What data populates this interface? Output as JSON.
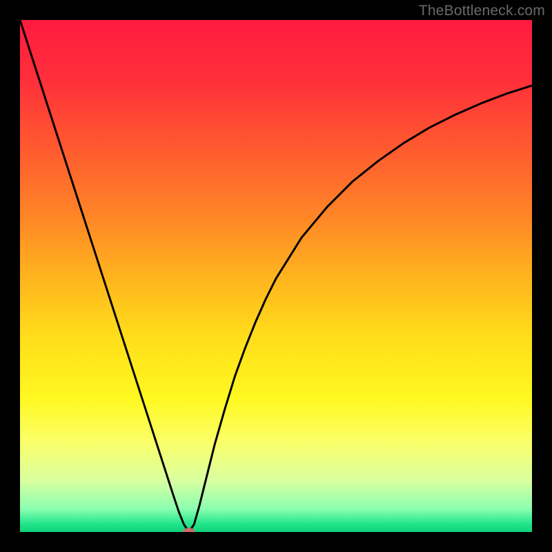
{
  "watermark": "TheBottleneck.com",
  "chart_data": {
    "type": "line",
    "title": "",
    "xlabel": "",
    "ylabel": "",
    "xlim": [
      0,
      100
    ],
    "ylim": [
      0,
      100
    ],
    "background": {
      "type": "vertical-gradient",
      "stops": [
        {
          "pos": 0.0,
          "color": "#ff1a3f"
        },
        {
          "pos": 0.12,
          "color": "#ff303a"
        },
        {
          "pos": 0.25,
          "color": "#ff5a2f"
        },
        {
          "pos": 0.38,
          "color": "#ff8427"
        },
        {
          "pos": 0.5,
          "color": "#ffb31e"
        },
        {
          "pos": 0.62,
          "color": "#ffde1a"
        },
        {
          "pos": 0.74,
          "color": "#fff821"
        },
        {
          "pos": 0.82,
          "color": "#fcff66"
        },
        {
          "pos": 0.9,
          "color": "#d9ffa0"
        },
        {
          "pos": 0.955,
          "color": "#8affb0"
        },
        {
          "pos": 0.985,
          "color": "#20e48a"
        },
        {
          "pos": 1.0,
          "color": "#0fd27a"
        }
      ]
    },
    "series": [
      {
        "name": "bottleneck-curve",
        "color": "#000000",
        "x": [
          0,
          2,
          4,
          6,
          8,
          10,
          12,
          14,
          16,
          18,
          20,
          22,
          24,
          26,
          28,
          30,
          31,
          32,
          33,
          34,
          35,
          36,
          38,
          40,
          42,
          44,
          46,
          48,
          50,
          55,
          60,
          65,
          70,
          75,
          80,
          85,
          90,
          95,
          100
        ],
        "y": [
          100,
          93.8,
          87.6,
          81.4,
          75.2,
          69.0,
          62.8,
          56.6,
          50.4,
          44.2,
          38.0,
          31.8,
          25.6,
          19.4,
          13.2,
          7.0,
          4.0,
          1.5,
          0.0,
          1.5,
          5.0,
          9.0,
          17.0,
          24.0,
          30.5,
          36.0,
          41.0,
          45.5,
          49.5,
          57.5,
          63.5,
          68.5,
          72.5,
          76.0,
          79.0,
          81.5,
          83.7,
          85.6,
          87.2
        ]
      }
    ],
    "marker": {
      "name": "optimal-point",
      "x": 33,
      "y": 0,
      "color": "#cc6d6d",
      "rx": 9,
      "ry": 6
    }
  }
}
